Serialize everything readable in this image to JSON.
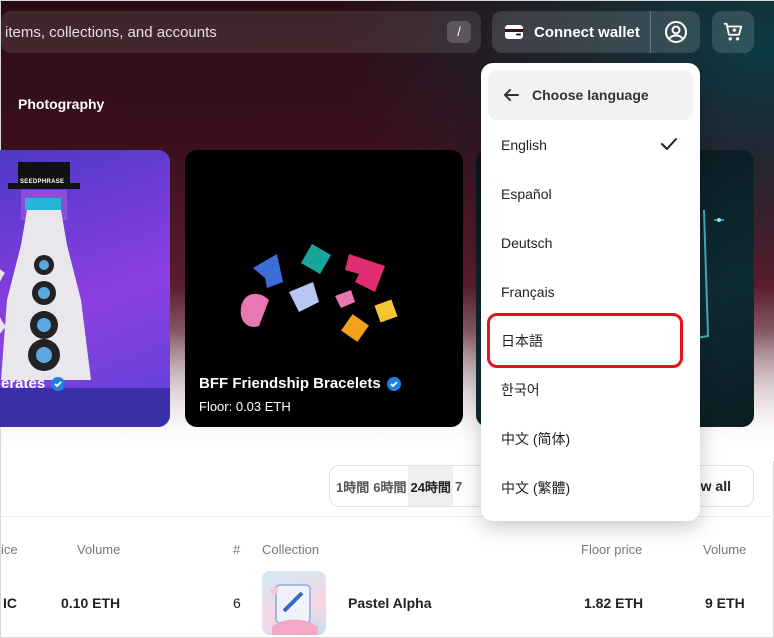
{
  "search": {
    "placeholder": "items, collections, and accounts",
    "shortcut": "/"
  },
  "header": {
    "connect_wallet": "Connect wallet"
  },
  "category_tabs": {
    "active": "Photography"
  },
  "cards": [
    {
      "title": "erates",
      "label": "SEEDPHRASE"
    },
    {
      "title": "BFF Friendship Bracelets",
      "floor": "Floor: 0.03 ETH"
    },
    {
      "title": ""
    }
  ],
  "time_tabs": [
    "1時間",
    "6時間",
    "24時間",
    "7"
  ],
  "view_all": "w all",
  "table_left": {
    "headers": {
      "price": "ice",
      "volume": "Volume"
    },
    "row": {
      "price": "IC",
      "volume": "0.10 ETH"
    }
  },
  "table_right": {
    "headers": {
      "rank": "#",
      "collection": "Collection",
      "floor": "Floor price",
      "volume": "Volume"
    },
    "row": {
      "rank": "6",
      "collection": "Pastel Alpha",
      "floor": "1.82 ETH",
      "volume": "9 ETH"
    }
  },
  "language_menu": {
    "header": "Choose language",
    "items": [
      "English",
      "Español",
      "Deutsch",
      "Français",
      "日本語",
      "한국어",
      "中文 (简体)",
      "中文 (繁體)"
    ],
    "selected": "English",
    "highlighted": "日本語"
  },
  "colors": {
    "highlight": "#e8121b",
    "verified": "#2081e2"
  }
}
